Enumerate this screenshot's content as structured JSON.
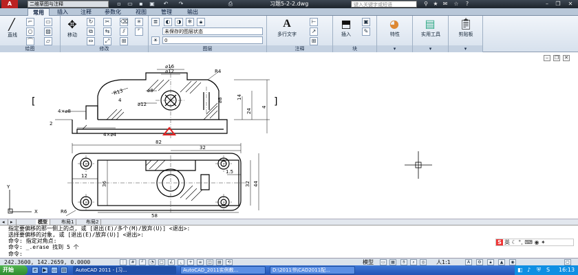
{
  "titlebar": {
    "logo": "A",
    "workspace": "二维草图与注释",
    "document_title": "习题5-2-2.dwg",
    "search_placeholder": "键入关键字或短语"
  },
  "ribbon_tabs": [
    "常用",
    "插入",
    "注释",
    "参数化",
    "视图",
    "管理",
    "输出"
  ],
  "ribbon": {
    "draw": {
      "label": "绘图",
      "line_label": "直线"
    },
    "modify": {
      "label": "修改",
      "move_label": "移动"
    },
    "layers": {
      "label": "图层",
      "layer_state": "未保存的图层状态",
      "current_layer": "0"
    },
    "annotation": {
      "label": "注释",
      "mtext_label": "多行文字"
    },
    "block": {
      "label": "块",
      "insert_label": "插入"
    },
    "properties_label": "特性",
    "utilities_label": "实用工具",
    "clipboard_label": "剪贴板"
  },
  "drawing": {
    "dims": {
      "d16": "⌀16",
      "d12_top": "⌀12",
      "r4": "R4",
      "r13": "R13",
      "d8": "⌀8",
      "d12": "⌀12",
      "d1": "4",
      "d2": "2",
      "d3": "4×⌀8",
      "d4": "4×⌀4",
      "d5": "⌀8",
      "d6": "14",
      "d7": "24",
      "d8v": "4",
      "w82": "82",
      "w32": "32",
      "w12": "12",
      "w58": "58",
      "r6": "R6",
      "h15": "1.5",
      "h32": "32",
      "h44": "44",
      "h36": "36"
    },
    "ucs_x": "X",
    "ucs_y": "Y",
    "bracket_left": "[",
    "bracket_right": "]"
  },
  "layout_tabs": [
    "模型",
    "布局1",
    "布局2"
  ],
  "command_lines": [
    "指定要偏移的那一侧上的点, 或 [退出(E)/多个(M)/放弃(U)] <退出>:",
    "选择要偏移的对象, 或 [退出(E)/放弃(U)] <退出>:",
    "命令: 指定对角点:",
    "命令: _.erase 找到 5 个",
    "命令:"
  ],
  "ime": {
    "logo": "S",
    "mode": "英"
  },
  "status": {
    "coords": "242.3600, 142.2659, 0.0000",
    "model": "模型",
    "scale": "人1:1"
  },
  "taskbar": {
    "start": "开始",
    "tasks": [
      "AutoCAD 2011 - [习...",
      "AutoCAD_2011实例教...",
      "D:\\2011书\\CAD2011配..."
    ],
    "clock": "16:13"
  },
  "colors": {
    "ribbon_bg": "#dfe8f2",
    "title_bg": "#2b333d",
    "taskbar": "#2b62c8",
    "start": "#3a9a3a",
    "triangle": "#e02020"
  }
}
